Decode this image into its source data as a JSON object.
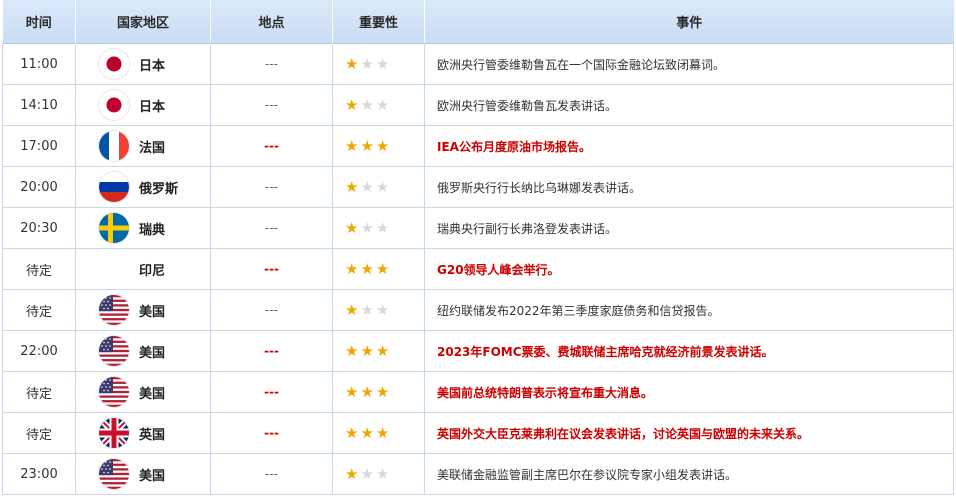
{
  "headers": {
    "time": "时间",
    "country": "国家地区",
    "place": "地点",
    "importance": "重要性",
    "event": "事件"
  },
  "rows": [
    {
      "time": "11:00",
      "flag": "japan",
      "country": "日本",
      "place": "---",
      "stars": 1,
      "event": "欧洲央行管委维勒鲁瓦在一个国际金融论坛致闭幕词。",
      "highlight": false
    },
    {
      "time": "14:10",
      "flag": "japan",
      "country": "日本",
      "place": "---",
      "stars": 1,
      "event": "欧洲央行管委维勒鲁瓦发表讲话。",
      "highlight": false
    },
    {
      "time": "17:00",
      "flag": "france",
      "country": "法国",
      "place": "---",
      "stars": 3,
      "event": "IEA公布月度原油市场报告。",
      "highlight": true
    },
    {
      "time": "20:00",
      "flag": "russia",
      "country": "俄罗斯",
      "place": "---",
      "stars": 1,
      "event": "俄罗斯央行行长纳比乌琳娜发表讲话。",
      "highlight": false
    },
    {
      "time": "20:30",
      "flag": "sweden",
      "country": "瑞典",
      "place": "---",
      "stars": 1,
      "event": "瑞典央行副行长弗洛登发表讲话。",
      "highlight": false
    },
    {
      "time": "待定",
      "flag": "none",
      "country": "印尼",
      "place": "---",
      "stars": 3,
      "event": "G20领导人峰会举行。",
      "highlight": true
    },
    {
      "time": "待定",
      "flag": "usa",
      "country": "美国",
      "place": "---",
      "stars": 1,
      "event": "纽约联储发布2022年第三季度家庭债务和信贷报告。",
      "highlight": false
    },
    {
      "time": "22:00",
      "flag": "usa",
      "country": "美国",
      "place": "---",
      "stars": 3,
      "event": "2023年FOMC票委、费城联储主席哈克就经济前景发表讲话。",
      "highlight": true
    },
    {
      "time": "待定",
      "flag": "usa",
      "country": "美国",
      "place": "---",
      "stars": 3,
      "event": "美国前总统特朗普表示将宣布重大消息。",
      "highlight": true
    },
    {
      "time": "待定",
      "flag": "uk",
      "country": "英国",
      "place": "---",
      "stars": 3,
      "event": "英国外交大臣克莱弗利在议会发表讲话，讨论英国与欧盟的未来关系。",
      "highlight": true
    },
    {
      "time": "23:00",
      "flag": "usa",
      "country": "美国",
      "place": "---",
      "stars": 1,
      "event": "美联储金融监管副主席巴尔在参议院专家小组发表讲话。",
      "highlight": false
    }
  ],
  "colors": {
    "highlight": "#cc0000",
    "star_on": "#f0a500",
    "star_off": "#d8d8d8",
    "header_bg": "#d3e4f9",
    "border": "#c9d7ea"
  }
}
